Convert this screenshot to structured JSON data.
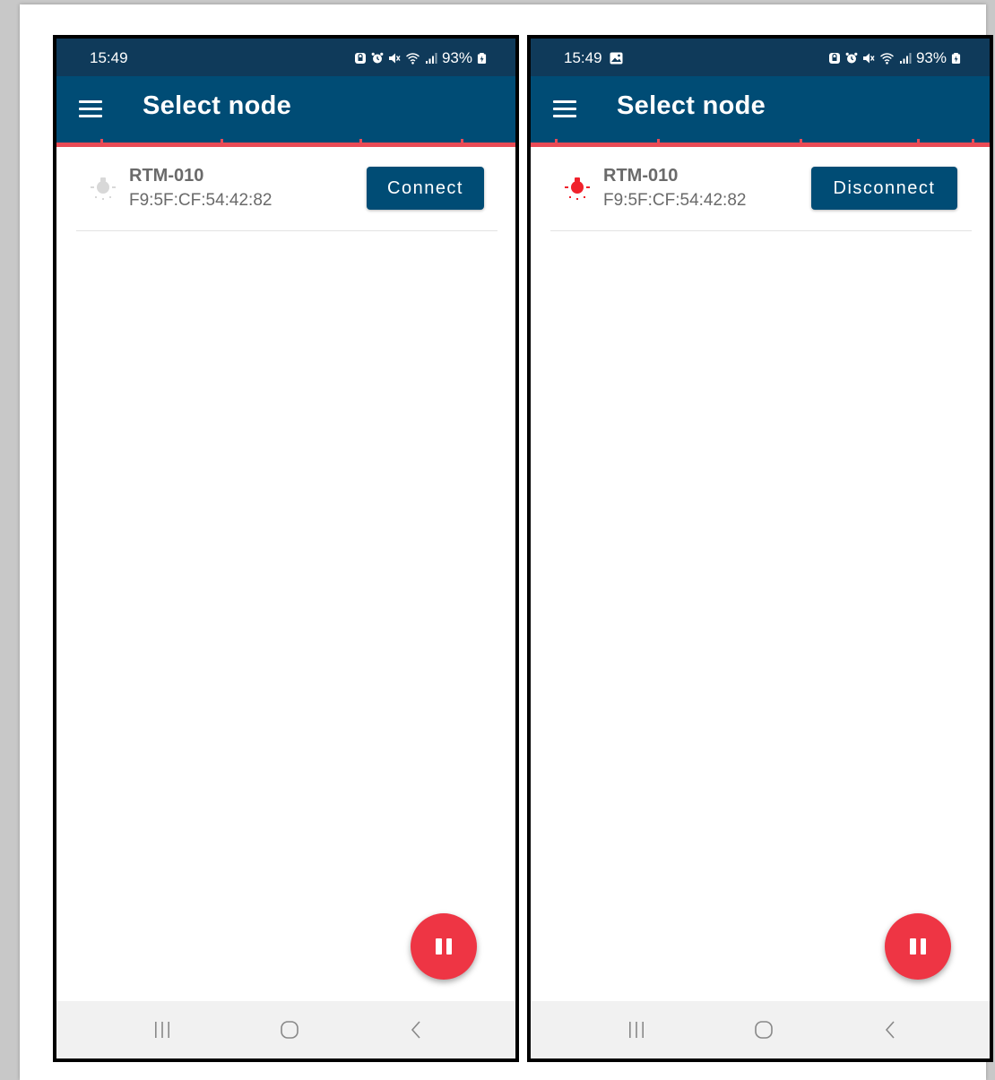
{
  "screens": [
    {
      "status_time": "15:49",
      "battery": "93%",
      "title": "Select node",
      "node": {
        "name": "RTM-010",
        "mac": "F9:5F:CF:54:42:82",
        "bulb_color": "#d8d8d8"
      },
      "button_label": "Connect",
      "show_gallery_icon": false
    },
    {
      "status_time": "15:49",
      "battery": "93%",
      "title": "Select node",
      "node": {
        "name": "RTM-010",
        "mac": "F9:5F:CF:54:42:82",
        "bulb_color": "#f0222c"
      },
      "button_label": "Disconnect",
      "show_gallery_icon": true
    }
  ],
  "icons": {
    "menu": "menu-icon",
    "bulb": "lightbulb-icon",
    "pause": "pause-icon",
    "recents": "recent-apps-icon",
    "home": "home-icon",
    "back": "back-icon"
  },
  "colors": {
    "statusbar": "#0f3a5a",
    "appbar": "#004c75",
    "accent_strip": "#ea4a55",
    "fab": "#ee3544",
    "button": "#004c75"
  }
}
